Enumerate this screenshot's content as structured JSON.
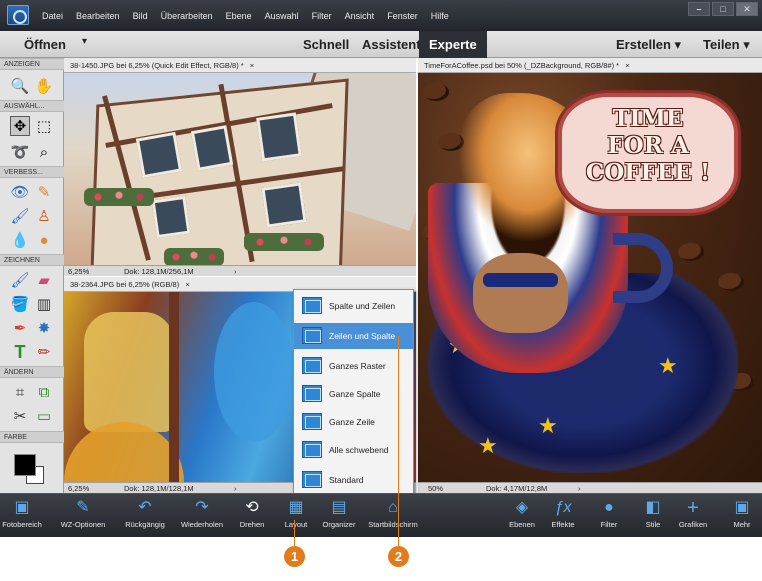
{
  "menubar": {
    "items": [
      "Datei",
      "Bearbeiten",
      "Bild",
      "Überarbeiten",
      "Ebene",
      "Auswahl",
      "Filter",
      "Ansicht",
      "Fenster",
      "Hilfe"
    ],
    "minimize": "–",
    "maximize": "□",
    "close": "✕"
  },
  "modebar": {
    "open": "Öffnen",
    "open_arrow": "▾",
    "quick": "Schnell",
    "guided": "Assistent",
    "expert": "Experte",
    "create": "Erstellen ▾",
    "share": "Teilen ▾"
  },
  "toolpanel": {
    "sections": [
      "ANZEIGEN",
      "AUSWÄHL...",
      "VERBESS...",
      "ZEICHNEN",
      "ÄNDERN",
      "FARBE"
    ]
  },
  "documents": {
    "house": {
      "tab": "38-1450.JPG bei 6,25% (Quick Edit Effect, RGB/8) *",
      "close": "×",
      "zoom": "6,25%",
      "doc": "Dok: 128,1M/256,1M",
      "arrow": "›"
    },
    "graffiti": {
      "tab": "38-2364.JPG bei 6,25% (RGB/8)",
      "close": "×",
      "zoom": "6,25%",
      "doc": "Dok: 128,1M/128,1M",
      "arrow": "›"
    },
    "coffee": {
      "tab": "TimeForACoffee.psd bei 50% (_DZBackground, RGB/8#) *",
      "close": "×",
      "zoom": "50%",
      "doc": "Dok: 4,17M/12,8M",
      "arrow": "›",
      "sign_lines": [
        "TIME",
        "FOR A",
        "COFFEE !"
      ]
    }
  },
  "layout_menu": {
    "items": [
      {
        "label": "Spalte und Zeilen"
      },
      {
        "label": "Zeilen und Spalte"
      },
      {
        "label": "Ganzes Raster"
      },
      {
        "label": "Ganze Spalte"
      },
      {
        "label": "Ganze Zeile"
      },
      {
        "label": "Alle schwebend"
      },
      {
        "label": "Standard"
      }
    ],
    "selected": "Zeilen und Spalte"
  },
  "taskbar": {
    "left": [
      "Fotobereich",
      "WZ-Optionen",
      "Rückgängig",
      "Wiederholen",
      "Drehen",
      "Layout",
      "Organizer",
      "Startbildschirm"
    ],
    "right": [
      "Ebenen",
      "Effekte",
      "Filter",
      "Stile",
      "Grafiken",
      "Mehr"
    ]
  },
  "callouts": [
    "1",
    "2"
  ]
}
